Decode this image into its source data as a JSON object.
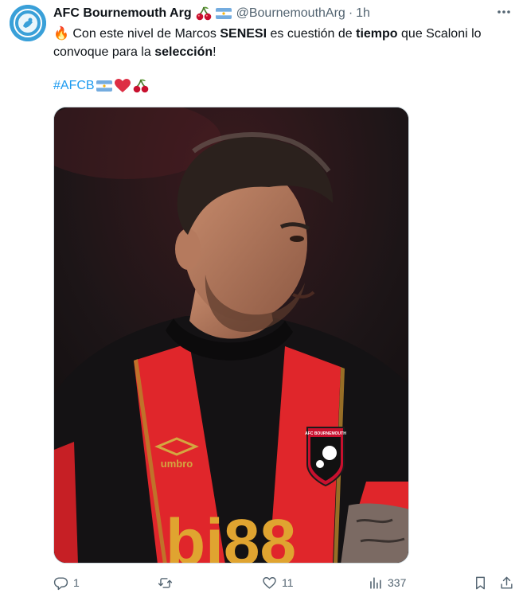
{
  "tweet": {
    "display_name": "AFC Bournemouth Arg",
    "handle": "@BournemouthArg",
    "separator": "·",
    "time": "1h",
    "text": {
      "fire_emoji": "🔥",
      "p1": "Con este nivel de Marcos ",
      "b1": "SENESI",
      "p2": " es cuestión de ",
      "b2": "tiempo",
      "p3": " que Scaloni lo convoque para la ",
      "b3": "selección",
      "p4": "!"
    },
    "hashtag": "#AFCB",
    "media": {
      "shirt_brand": "umbro",
      "sponsor": "bi88",
      "crest_text": "AFC BOURNEMOUTH"
    },
    "actions": {
      "reply_count": "1",
      "retweet_count": "",
      "like_count": "11",
      "view_count": "337"
    },
    "icons": [
      "cherries-icon",
      "argentina-flag-icon",
      "more-icon",
      "fire-icon",
      "heart-emoji-icon",
      "reply-icon",
      "retweet-icon",
      "like-icon",
      "views-icon",
      "bookmark-icon",
      "share-icon"
    ],
    "colors": {
      "link": "#1d9bf0",
      "secondary": "#536471",
      "kit_red": "#e0262b",
      "kit_black": "#141214"
    }
  }
}
